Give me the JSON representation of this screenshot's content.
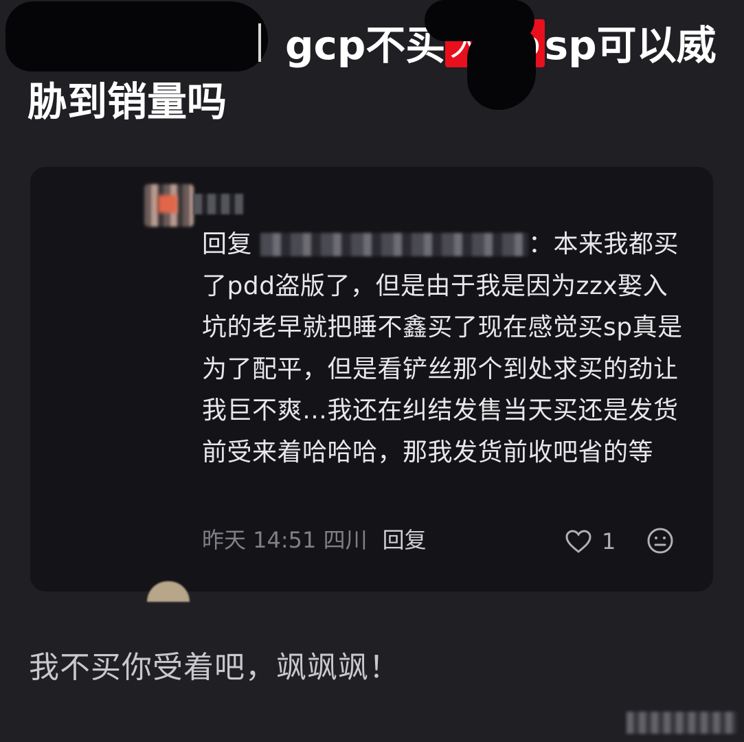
{
  "post": {
    "title_line1_a": "gcp不买",
    "title_tag": "大top",
    "title_line1_b": "sp可以威",
    "title_line2": "胁到销量吗"
  },
  "comment": {
    "reply_prefix": "回复",
    "reply_suffix": "：本来我都买了pdd盗版了，但是由于我是因为zzx娶入坑的老早就把睡不鑫买了现在感觉买sp真是为了配平，但是看铲丝那个到处求买的劲让我巨不爽…我还在纠结发售当天买还是发货前受来着哈哈哈，那我发货前收吧省的等",
    "time": "昨天 14:51 四川",
    "reply_button": "回复",
    "like_count": "1"
  },
  "caption": "我不买你受着吧，飒飒飒！",
  "colors": {
    "background": "#1f1f24",
    "card": "#141418",
    "tag_red": "#e8101c",
    "meta_text": "#808086"
  },
  "icons": [
    "heart-icon",
    "emoji-icon"
  ]
}
